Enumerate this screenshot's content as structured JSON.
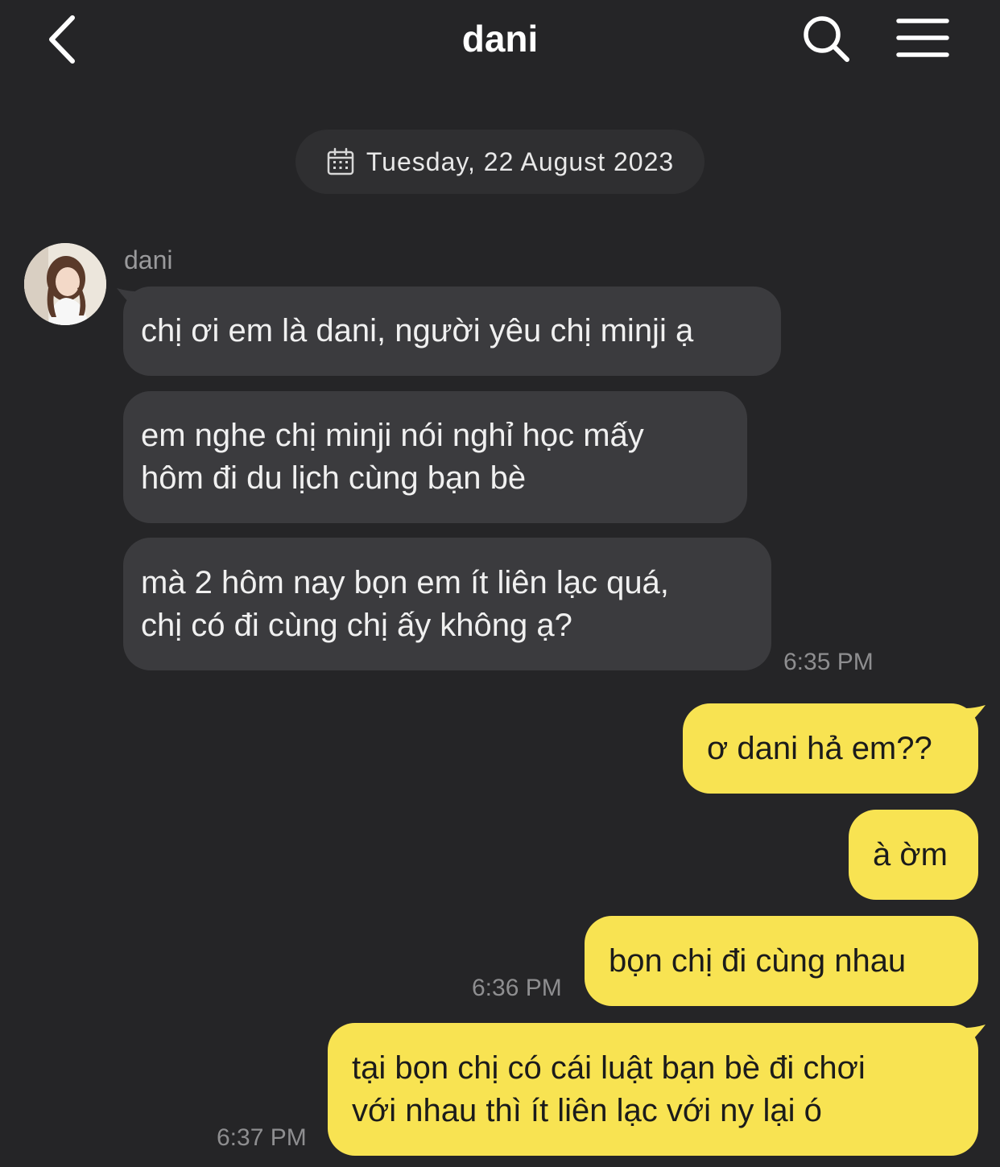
{
  "header": {
    "title": "dani",
    "back_icon": "chevron-left-icon",
    "search_icon": "search-icon",
    "menu_icon": "hamburger-menu-icon"
  },
  "date_divider": {
    "icon": "calendar-icon",
    "text": "Tuesday, 22 August 2023"
  },
  "sender": {
    "name": "dani"
  },
  "incoming_messages": [
    {
      "text": "chị ơi em là dani, người yêu chị minji ạ"
    },
    {
      "text": "em nghe chị minji nói nghỉ học mấy\nhôm đi du lịch cùng bạn bè"
    },
    {
      "text": "mà 2 hôm nay bọn em ít liên lạc quá,\nchị có đi cùng chị ấy không ạ?"
    }
  ],
  "incoming_time": "6:35 PM",
  "outgoing_messages": [
    {
      "text": "ơ dani hả em??"
    },
    {
      "text": "à ờm"
    },
    {
      "text": "bọn chị đi cùng nhau"
    },
    {
      "text": "tại bọn chị có cái luật bạn bè đi chơi\nvới nhau thì ít liên lạc với ny lại ó"
    }
  ],
  "outgoing_times": [
    "6:36 PM",
    "6:37 PM"
  ],
  "colors": {
    "background": "#252527",
    "incoming_bubble": "#3b3b3e",
    "outgoing_bubble": "#f8e352",
    "timestamp": "#8e8e90"
  }
}
